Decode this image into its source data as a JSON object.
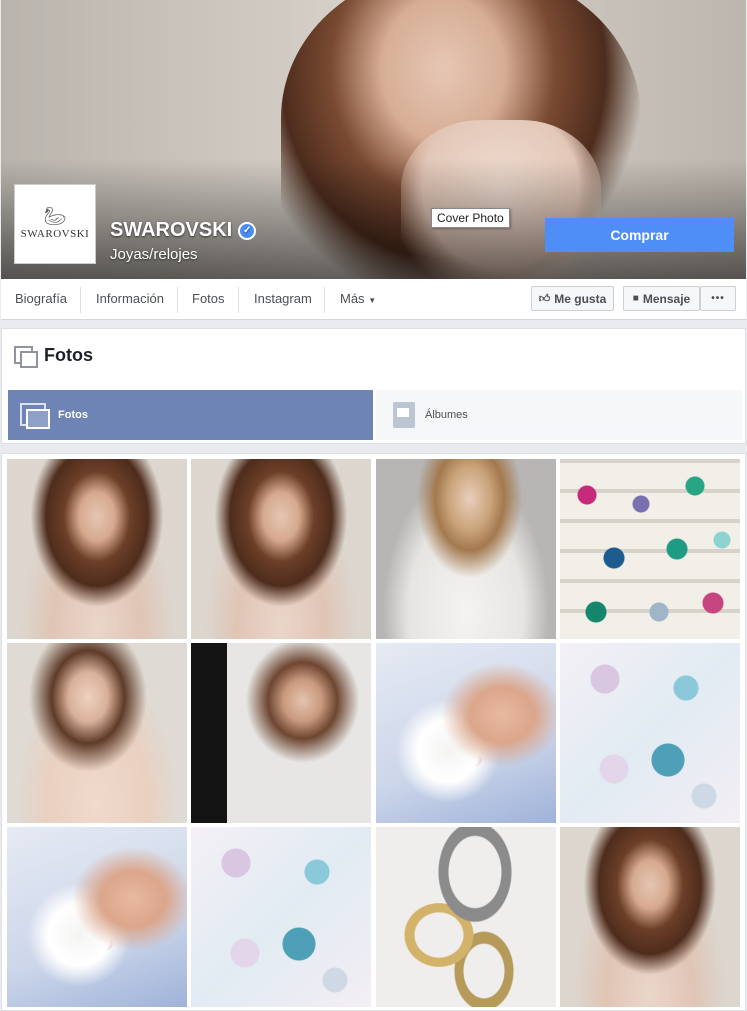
{
  "cover": {
    "tooltip": "Cover Photo",
    "buy_label": "Comprar"
  },
  "profile": {
    "logo_text": "SWAROVSKI",
    "name": "SWAROVSKI",
    "category": "Joyas/relojes"
  },
  "nav": {
    "items": [
      "Biografía",
      "Información",
      "Fotos",
      "Instagram",
      "Más"
    ],
    "like_label": "Me gusta",
    "message_label": "Mensaje",
    "more_label": "•••"
  },
  "photos_section": {
    "title": "Fotos",
    "tabs": [
      "Fotos",
      "Álbumes"
    ]
  },
  "photos": [
    {
      "icon": "model-bracelets-photo"
    },
    {
      "icon": "model-bracelets-photo"
    },
    {
      "icon": "blonde-model-photo"
    },
    {
      "icon": "crystals-tray-photo"
    },
    {
      "icon": "brunette-watch-photo"
    },
    {
      "icon": "studio-shoot-photo"
    },
    {
      "icon": "design-hands-photo"
    },
    {
      "icon": "moodboard-photo"
    },
    {
      "icon": "design-hands-photo"
    },
    {
      "icon": "moodboard-photo"
    },
    {
      "icon": "bracelets-photo"
    },
    {
      "icon": "model-bracelets-photo"
    }
  ],
  "colors": {
    "accent": "#4f8ef7",
    "tab_active": "#6d84b4",
    "verified": "#4b8df8"
  }
}
